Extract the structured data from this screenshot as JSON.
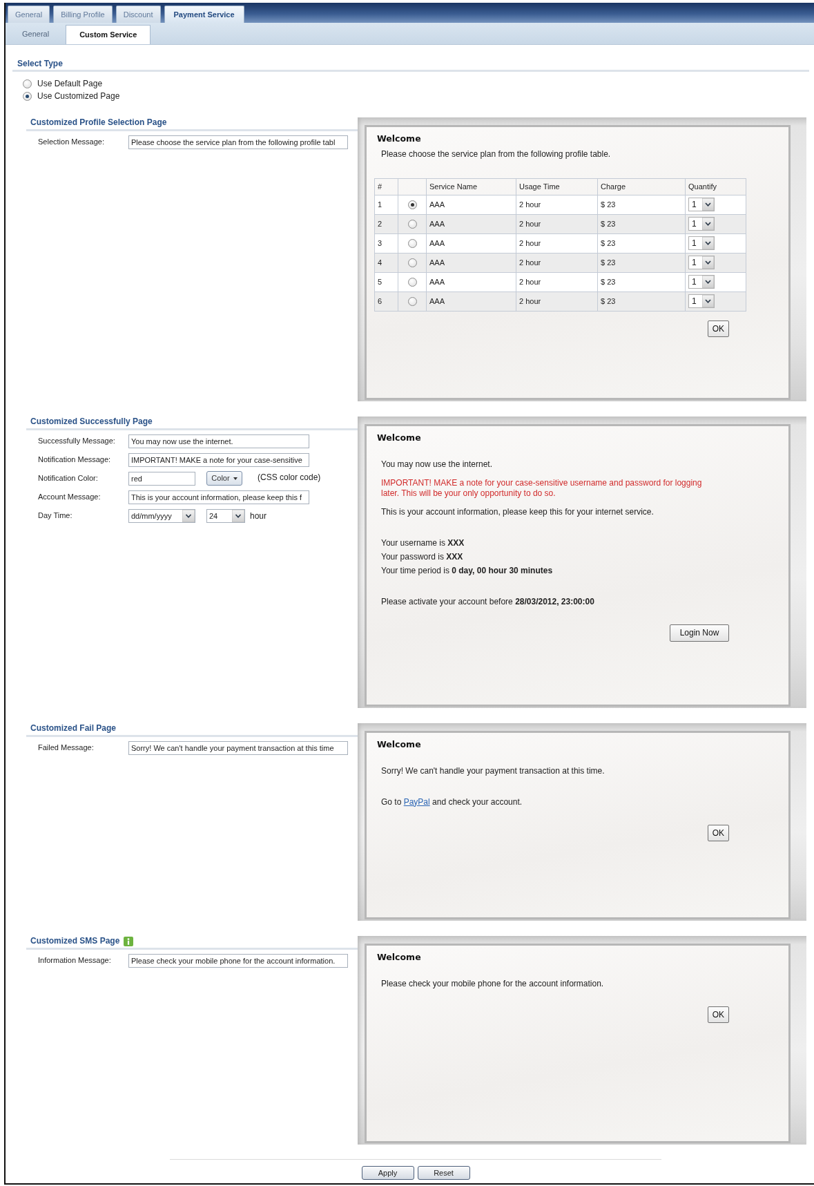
{
  "tabs": [
    {
      "label": "General",
      "selected": false
    },
    {
      "label": "Billing Profile",
      "selected": false
    },
    {
      "label": "Discount",
      "selected": false
    },
    {
      "label": "Payment Service",
      "selected": true
    }
  ],
  "subtabs": [
    {
      "label": "General",
      "selected": false
    },
    {
      "label": "Custom Service",
      "selected": true
    }
  ],
  "select_type": {
    "title": "Select Type",
    "options": [
      {
        "label": "Use Default Page",
        "selected": false
      },
      {
        "label": "Use Customized Page",
        "selected": true
      }
    ]
  },
  "sections": [
    {
      "title": "Customized Profile Selection Page",
      "fields": [
        {
          "kind": "text",
          "label": "Selection Message:",
          "value": "Please choose the service plan from the following profile tabl"
        }
      ],
      "preview": {
        "title": "Welcome",
        "message": "Please choose the service plan from the following profile table.",
        "table": {
          "columns": {
            "number": "#",
            "service_name": "Service Name",
            "usage_time": "Usage Time",
            "charge": "Charge",
            "quantity": "Quantify"
          },
          "rows": [
            {
              "number": "1",
              "selected": true,
              "service_name": "AAA",
              "usage_time": "2 hour",
              "charge": "$ 23",
              "quantity": "1"
            },
            {
              "number": "2",
              "selected": false,
              "service_name": "AAA",
              "usage_time": "2 hour",
              "charge": "$ 23",
              "quantity": "1"
            },
            {
              "number": "3",
              "selected": false,
              "service_name": "AAA",
              "usage_time": "2 hour",
              "charge": "$ 23",
              "quantity": "1"
            },
            {
              "number": "4",
              "selected": false,
              "service_name": "AAA",
              "usage_time": "2 hour",
              "charge": "$ 23",
              "quantity": "1"
            },
            {
              "number": "5",
              "selected": false,
              "service_name": "AAA",
              "usage_time": "2 hour",
              "charge": "$ 23",
              "quantity": "1"
            },
            {
              "number": "6",
              "selected": false,
              "service_name": "AAA",
              "usage_time": "2 hour",
              "charge": "$ 23",
              "quantity": "1"
            }
          ]
        },
        "button": {
          "kind": "ok",
          "label": "OK"
        }
      }
    },
    {
      "title": "Customized Successfully Page",
      "fields": [
        {
          "kind": "text",
          "label": "Successfully Message:",
          "value": "You may now use the internet."
        },
        {
          "kind": "text",
          "label": "Notification Message:",
          "value": "IMPORTANT! MAKE a note for your case-sensitive"
        },
        {
          "kind": "color",
          "label": "Notification Color:",
          "value": "red",
          "button": "Color",
          "hint": "(CSS color code)"
        },
        {
          "kind": "text",
          "label": "Account Message:",
          "value": "This is your account information, please keep this f"
        },
        {
          "kind": "datetime",
          "label": "Day Time:",
          "date": "dd/mm/yyyy",
          "hour": "24",
          "unit": "hour"
        }
      ],
      "preview": {
        "title": "Welcome",
        "lines": [
          {
            "kind": "text",
            "text": "You may now use the internet."
          },
          {
            "kind": "notice",
            "text": "IMPORTANT! MAKE a note for your case-sensitive username and password for logging later. This will be your only opportunity to do so."
          },
          {
            "kind": "text",
            "text": "This is your account information, please keep this for your internet service."
          },
          {
            "kind": "account",
            "text": "Your username is **XXX**"
          },
          {
            "kind": "account",
            "text": "Your password is **XXX**"
          },
          {
            "kind": "account",
            "text": "Your time period is **0 day, 00 hour 30 minutes**"
          },
          {
            "kind": "deadline",
            "text": "Please activate your account before **28/03/2012, 23:00:00**"
          }
        ],
        "button": {
          "kind": "login",
          "label": "Login Now"
        }
      }
    },
    {
      "title": "Customized Fail Page",
      "fields": [
        {
          "kind": "text",
          "label": "Failed Message:",
          "value": "Sorry! We can't handle your payment transaction at this time"
        }
      ],
      "preview": {
        "title": "Welcome",
        "lines": [
          {
            "kind": "text",
            "text": "Sorry! We can't handle your payment transaction at this time."
          },
          {
            "kind": "link",
            "before": "Go to",
            "link": "PayPal",
            "after": "and check your account."
          }
        ],
        "button": {
          "kind": "ok",
          "label": "OK"
        }
      }
    },
    {
      "title": "Customized SMS Page",
      "info": true,
      "fields": [
        {
          "kind": "text",
          "label": "Information Message:",
          "value": "Please check your mobile phone for the account information."
        }
      ],
      "preview": {
        "title": "Welcome",
        "lines": [
          {
            "kind": "text",
            "text": "Please check your mobile phone for the account information."
          }
        ],
        "button": {
          "kind": "ok",
          "label": "OK"
        }
      }
    }
  ],
  "buttons": [
    "Apply",
    "Reset"
  ]
}
